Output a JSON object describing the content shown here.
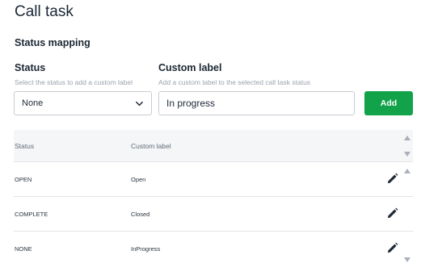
{
  "page": {
    "title": "Call task"
  },
  "section": {
    "title": "Status mapping"
  },
  "status_field": {
    "label": "Status",
    "help": "Select the status to add a custom label",
    "selected": "None",
    "icon": "chevron-down-icon"
  },
  "custom_field": {
    "label": "Custom label",
    "help": "Add a custom label to the selected call task status",
    "value": "In progress"
  },
  "add_button": {
    "label": "Add",
    "color": "#12a34a"
  },
  "table": {
    "headers": {
      "status": "Status",
      "custom_label": "Custom label"
    },
    "rows": [
      {
        "status": "OPEN",
        "custom_label": "Open",
        "action_icon": "pencil-icon"
      },
      {
        "status": "COMPLETE",
        "custom_label": "Closed",
        "action_icon": "pencil-icon"
      },
      {
        "status": "NONE",
        "custom_label": "InProgress",
        "action_icon": "pencil-icon"
      }
    ]
  }
}
